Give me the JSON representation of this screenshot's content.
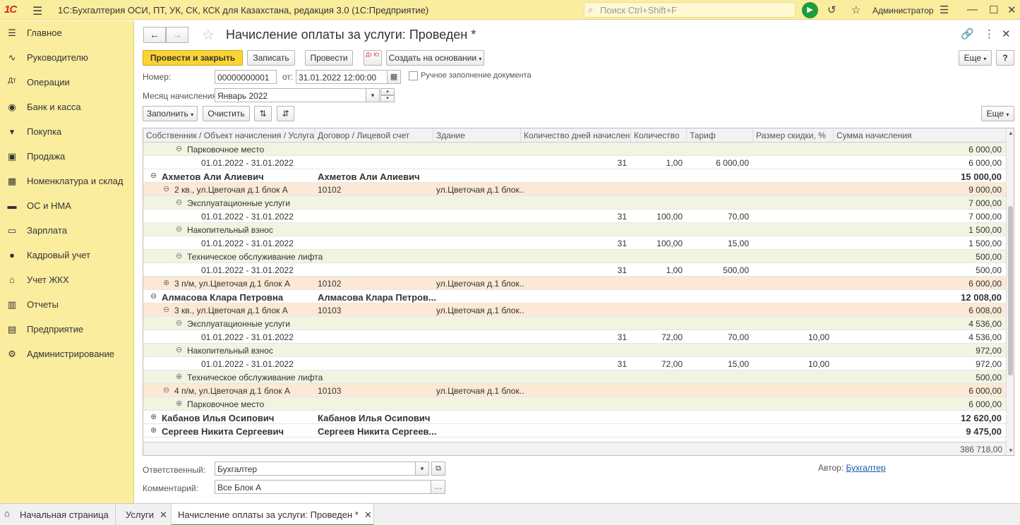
{
  "titlebar": {
    "logo": "1С",
    "title": "1С:Бухгалтерия ОСИ, ПТ, УК, СК, КСК для Казахстана, редакция 3.0  (1С:Предприятие)",
    "search_placeholder": "Поиск Ctrl+Shift+F",
    "user": "Администратор"
  },
  "sidebar": {
    "items": [
      {
        "label": "Главное",
        "icon": "menu-icon"
      },
      {
        "label": "Руководителю",
        "icon": "chart-icon"
      },
      {
        "label": "Операции",
        "icon": "dt-kt-icon"
      },
      {
        "label": "Банк и касса",
        "icon": "cash-icon"
      },
      {
        "label": "Покупка",
        "icon": "cart-icon"
      },
      {
        "label": "Продажа",
        "icon": "bag-icon"
      },
      {
        "label": "Номенклатура и склад",
        "icon": "grid-icon"
      },
      {
        "label": "ОС и НМА",
        "icon": "truck-icon"
      },
      {
        "label": "Зарплата",
        "icon": "wallet-icon"
      },
      {
        "label": "Кадровый учет",
        "icon": "people-icon"
      },
      {
        "label": "Учет ЖКХ",
        "icon": "house-icon"
      },
      {
        "label": "Отчеты",
        "icon": "bars-icon"
      },
      {
        "label": "Предприятие",
        "icon": "building-icon"
      },
      {
        "label": "Администрирование",
        "icon": "gear-icon"
      }
    ]
  },
  "document": {
    "title": "Начисление оплаты за услуги: Проведен *",
    "toolbar": {
      "post_close": "Провести и закрыть",
      "save": "Записать",
      "post": "Провести",
      "dtkt": "Дт Кт",
      "create_based": "Создать на основании",
      "more": "Еще",
      "help": "?"
    },
    "number_label": "Номер:",
    "number_value": "00000000001",
    "date_label": "от:",
    "date_value": "31.01.2022 12:00:00",
    "manual_label": "Ручное заполнение документа",
    "month_label": "Месяц начисления:",
    "month_value": "Январь 2022",
    "fill_btn": "Заполнить",
    "clear_btn": "Очистить",
    "table_more": "Еще",
    "responsible_label": "Ответственный:",
    "responsible_value": "Бухгалтер",
    "comment_label": "Комментарий:",
    "comment_value": "Все Блок А",
    "author_label": "Автор:",
    "author_value": "Бухгалтер"
  },
  "table": {
    "columns": [
      "Собственник / Объект начисления / Услуга ...",
      "Договор / Лицевой счет",
      "Здание",
      "Количество дней начисления",
      "Количество",
      "Тариф",
      "Размер скидки, %",
      "Сумма начисления"
    ],
    "rows": [
      {
        "type": "service",
        "exp": "⊖",
        "name": "Парковочное место",
        "contract": "",
        "building": "",
        "days": "",
        "qty": "",
        "tariff": "",
        "discount": "",
        "sum": "6 000,00"
      },
      {
        "type": "period",
        "exp": "",
        "name": "01.01.2022 - 31.01.2022",
        "contract": "",
        "building": "",
        "days": "31",
        "qty": "1,00",
        "tariff": "6 000,00",
        "discount": "",
        "sum": "6 000,00"
      },
      {
        "type": "owner",
        "exp": "⊖",
        "name": "Ахметов Али Алиевич",
        "contract": "Ахметов Али Алиевич",
        "building": "",
        "days": "",
        "qty": "",
        "tariff": "",
        "discount": "",
        "sum": "15 000,00"
      },
      {
        "type": "object",
        "exp": "⊖",
        "name": "2 кв., ул.Цветочая д.1 блок А",
        "contract": "10102",
        "building": "ул.Цветочая д.1 блок...",
        "days": "",
        "qty": "",
        "tariff": "",
        "discount": "",
        "sum": "9 000,00"
      },
      {
        "type": "service",
        "exp": "⊖",
        "name": "Эксплуатационные услуги",
        "contract": "",
        "building": "",
        "days": "",
        "qty": "",
        "tariff": "",
        "discount": "",
        "sum": "7 000,00"
      },
      {
        "type": "period",
        "exp": "",
        "name": "01.01.2022 - 31.01.2022",
        "contract": "",
        "building": "",
        "days": "31",
        "qty": "100,00",
        "tariff": "70,00",
        "discount": "",
        "sum": "7 000,00"
      },
      {
        "type": "service",
        "exp": "⊖",
        "name": "Накопительный взнос",
        "contract": "",
        "building": "",
        "days": "",
        "qty": "",
        "tariff": "",
        "discount": "",
        "sum": "1 500,00"
      },
      {
        "type": "period",
        "exp": "",
        "name": "01.01.2022 - 31.01.2022",
        "contract": "",
        "building": "",
        "days": "31",
        "qty": "100,00",
        "tariff": "15,00",
        "discount": "",
        "sum": "1 500,00"
      },
      {
        "type": "service",
        "exp": "⊖",
        "name": "Техническое обслуживание лифта",
        "contract": "",
        "building": "",
        "days": "",
        "qty": "",
        "tariff": "",
        "discount": "",
        "sum": "500,00"
      },
      {
        "type": "period",
        "exp": "",
        "name": "01.01.2022 - 31.01.2022",
        "contract": "",
        "building": "",
        "days": "31",
        "qty": "1,00",
        "tariff": "500,00",
        "discount": "",
        "sum": "500,00"
      },
      {
        "type": "object",
        "exp": "⊕",
        "name": "3 п/м, ул.Цветочая д.1 блок А",
        "contract": "10102",
        "building": "ул.Цветочая д.1 блок...",
        "days": "",
        "qty": "",
        "tariff": "",
        "discount": "",
        "sum": "6 000,00"
      },
      {
        "type": "owner",
        "exp": "⊖",
        "name": "Алмасова Клара Петровна",
        "contract": "Алмасова Клара Петров...",
        "building": "",
        "days": "",
        "qty": "",
        "tariff": "",
        "discount": "",
        "sum": "12 008,00"
      },
      {
        "type": "object",
        "exp": "⊖",
        "name": "3 кв., ул.Цветочая д.1 блок А",
        "contract": "10103",
        "building": "ул.Цветочая д.1 блок...",
        "days": "",
        "qty": "",
        "tariff": "",
        "discount": "",
        "sum": "6 008,00"
      },
      {
        "type": "service",
        "exp": "⊖",
        "name": "Эксплуатационные услуги",
        "contract": "",
        "building": "",
        "days": "",
        "qty": "",
        "tariff": "",
        "discount": "",
        "sum": "4 536,00"
      },
      {
        "type": "period",
        "exp": "",
        "name": "01.01.2022 - 31.01.2022",
        "contract": "",
        "building": "",
        "days": "31",
        "qty": "72,00",
        "tariff": "70,00",
        "discount": "10,00",
        "sum": "4 536,00"
      },
      {
        "type": "service",
        "exp": "⊖",
        "name": "Накопительный взнос",
        "contract": "",
        "building": "",
        "days": "",
        "qty": "",
        "tariff": "",
        "discount": "",
        "sum": "972,00"
      },
      {
        "type": "period",
        "exp": "",
        "name": "01.01.2022 - 31.01.2022",
        "contract": "",
        "building": "",
        "days": "31",
        "qty": "72,00",
        "tariff": "15,00",
        "discount": "10,00",
        "sum": "972,00"
      },
      {
        "type": "service",
        "exp": "⊕",
        "name": "Техническое обслуживание лифта",
        "contract": "",
        "building": "",
        "days": "",
        "qty": "",
        "tariff": "",
        "discount": "",
        "sum": "500,00"
      },
      {
        "type": "object",
        "exp": "⊖",
        "name": "4 п/м, ул.Цветочая д.1 блок А",
        "contract": "10103",
        "building": "ул.Цветочая д.1 блок...",
        "days": "",
        "qty": "",
        "tariff": "",
        "discount": "",
        "sum": "6 000,00"
      },
      {
        "type": "service",
        "exp": "⊕",
        "name": "Парковочное место",
        "contract": "",
        "building": "",
        "days": "",
        "qty": "",
        "tariff": "",
        "discount": "",
        "sum": "6 000,00"
      },
      {
        "type": "owner",
        "exp": "⊕",
        "name": "Кабанов Илья Осипович",
        "contract": "Кабанов Илья Осипович",
        "building": "",
        "days": "",
        "qty": "",
        "tariff": "",
        "discount": "",
        "sum": "12 620,00"
      },
      {
        "type": "owner",
        "exp": "⊕",
        "name": "Сергеев Никита Сергеевич",
        "contract": "Сергеев Никита Сергеев...",
        "building": "",
        "days": "",
        "qty": "",
        "tariff": "",
        "discount": "",
        "sum": "9 475,00"
      }
    ],
    "total": "386 718,00"
  },
  "tabs": [
    {
      "label": "Начальная страница",
      "closable": false
    },
    {
      "label": "Услуги",
      "closable": true
    },
    {
      "label": "Начисление оплаты за услуги: Проведен *",
      "closable": true
    }
  ],
  "colors": {
    "accent_yellow": "#fbed9e",
    "primary_button": "#fbd434",
    "object_row": "#fbe9d6",
    "service_row": "#f2f4e2",
    "active_tab": "#1e9c3a"
  }
}
